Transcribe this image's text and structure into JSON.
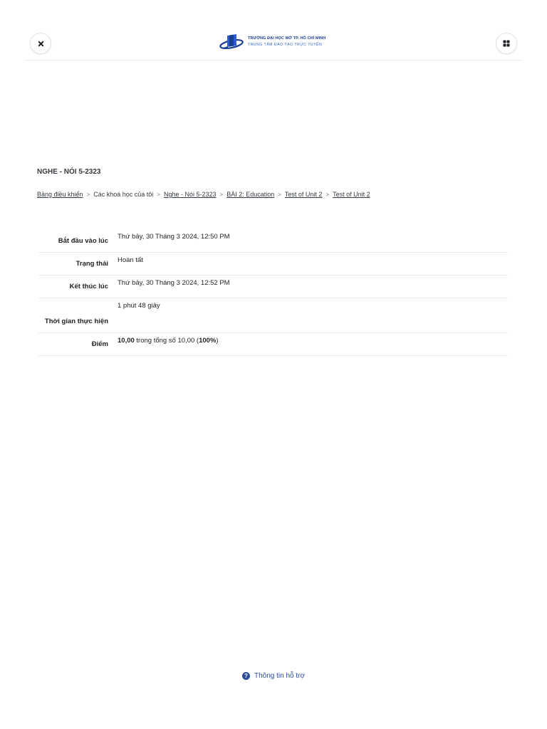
{
  "header": {
    "logo_line1": "TRƯỜNG ĐẠI HỌC MỞ TP. HỒ CHÍ MINH",
    "logo_line2": "TRUNG TÂM ĐÀO TẠO TRỰC TUYẾN",
    "close_icon": "close-icon",
    "menu_icon": "grid-icon",
    "brand_color": "#1b3f8f"
  },
  "course": {
    "title": "NGHE - NÓI 5-2323"
  },
  "breadcrumb": {
    "items": [
      {
        "label": "Bảng điều khiển",
        "link": true
      },
      {
        "label": "Các khoá học của tôi",
        "link": false
      },
      {
        "label": "Nghe - Nói 5-2323",
        "link": true
      },
      {
        "label": "BÀI 2: Education",
        "link": true
      },
      {
        "label": "Test of Unit 2",
        "link": true
      },
      {
        "label": "Test of Unit 2",
        "link": true
      }
    ],
    "separator": ">"
  },
  "summary": {
    "started_label": "Bắt đầu vào lúc",
    "started_value": "Thứ bảy, 30 Tháng 3 2024, 12:50 PM",
    "state_label": "Trạng thái",
    "state_value": "Hoàn tất",
    "completed_label": "Kết thúc lúc",
    "completed_value": "Thứ bảy, 30 Tháng 3 2024, 12:52 PM",
    "duration_label": "Thời gian thực hiện",
    "duration_value": "1 phút 48 giây",
    "grade_label": "Điểm",
    "grade_score": "10,00",
    "grade_middle": " trong tổng số 10,00 (",
    "grade_percent": "100%",
    "grade_end": ")"
  },
  "footer": {
    "help_label": "Thông tin hỗ trợ",
    "help_icon": "question-circle-icon"
  }
}
